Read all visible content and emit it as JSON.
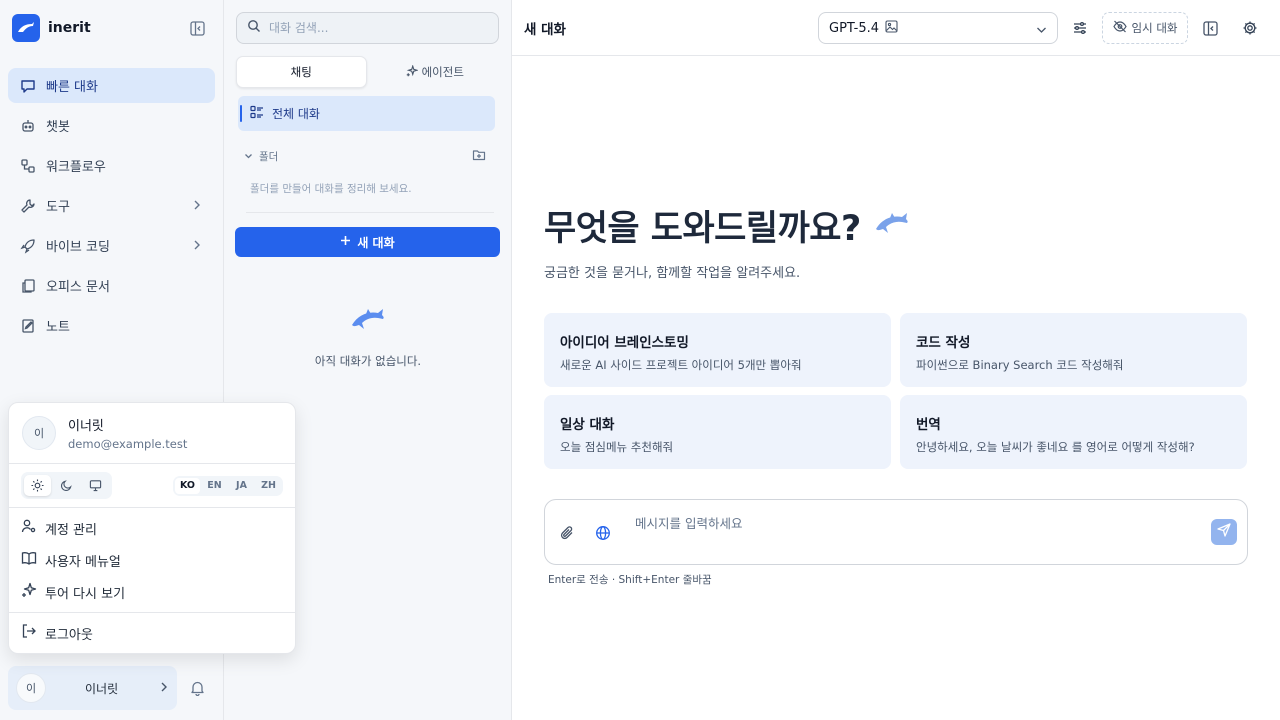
{
  "brand": {
    "name": "inerit"
  },
  "sidebar": {
    "items": [
      {
        "label": "빠른 대화",
        "icon": "chat-bubble-icon"
      },
      {
        "label": "챗봇",
        "icon": "bot-icon"
      },
      {
        "label": "워크플로우",
        "icon": "workflow-icon"
      },
      {
        "label": "도구",
        "icon": "wrench-icon"
      },
      {
        "label": "바이브 코딩",
        "icon": "rocket-icon"
      },
      {
        "label": "오피스 문서",
        "icon": "documents-icon"
      },
      {
        "label": "노트",
        "icon": "notebook-icon"
      }
    ],
    "footer": {
      "avatar_initial": "이",
      "name": "이너릿"
    }
  },
  "user_popup": {
    "avatar_initial": "이",
    "name": "이너릿",
    "email": "demo@example.test",
    "languages": [
      "KO",
      "EN",
      "JA",
      "ZH"
    ],
    "selected_language": "KO",
    "menu": [
      {
        "label": "계정 관리",
        "icon": "user-settings-icon"
      },
      {
        "label": "사용자 메뉴얼",
        "icon": "book-icon"
      },
      {
        "label": "투어 다시 보기",
        "icon": "sparkles-icon"
      }
    ],
    "logout_label": "로그아웃"
  },
  "conversations": {
    "search_placeholder": "대화 검색...",
    "tabs": [
      {
        "label": "채팅"
      },
      {
        "label": "에이전트"
      }
    ],
    "all_label": "전체 대화",
    "folder_label": "폴더",
    "folder_hint": "폴더를 만들어 대화를 정리해 보세요.",
    "new_chat_label": "새 대화",
    "empty_text": "아직 대화가 없습니다."
  },
  "main": {
    "title": "새 대화",
    "model": "GPT-5.4",
    "temp_chat_label": "임시 대화",
    "hero_title": "무엇을 도와드릴까요?",
    "hero_subtitle": "궁금한 것을 묻거나, 함께할 작업을 알려주세요.",
    "suggestions": [
      {
        "title": "아이디어 브레인스토밍",
        "desc": "새로운 AI 사이드 프로젝트 아이디어 5개만 뽑아줘"
      },
      {
        "title": "코드 작성",
        "desc": "파이썬으로 Binary Search 코드 작성해줘"
      },
      {
        "title": "일상 대화",
        "desc": "오늘 점심메뉴 추천해줘"
      },
      {
        "title": "번역",
        "desc": "안녕하세요, 오늘 날씨가 좋네요 를 영어로 어떻게 작성해?"
      }
    ],
    "input_placeholder": "메시지를 입력하세요",
    "input_hint": "Enter로 전송 · Shift+Enter 줄바꿈"
  },
  "colors": {
    "accent": "#2563eb",
    "active_bg": "#dbe8fb",
    "card_bg": "#eef3fc",
    "dolphin": "#5b8def"
  }
}
